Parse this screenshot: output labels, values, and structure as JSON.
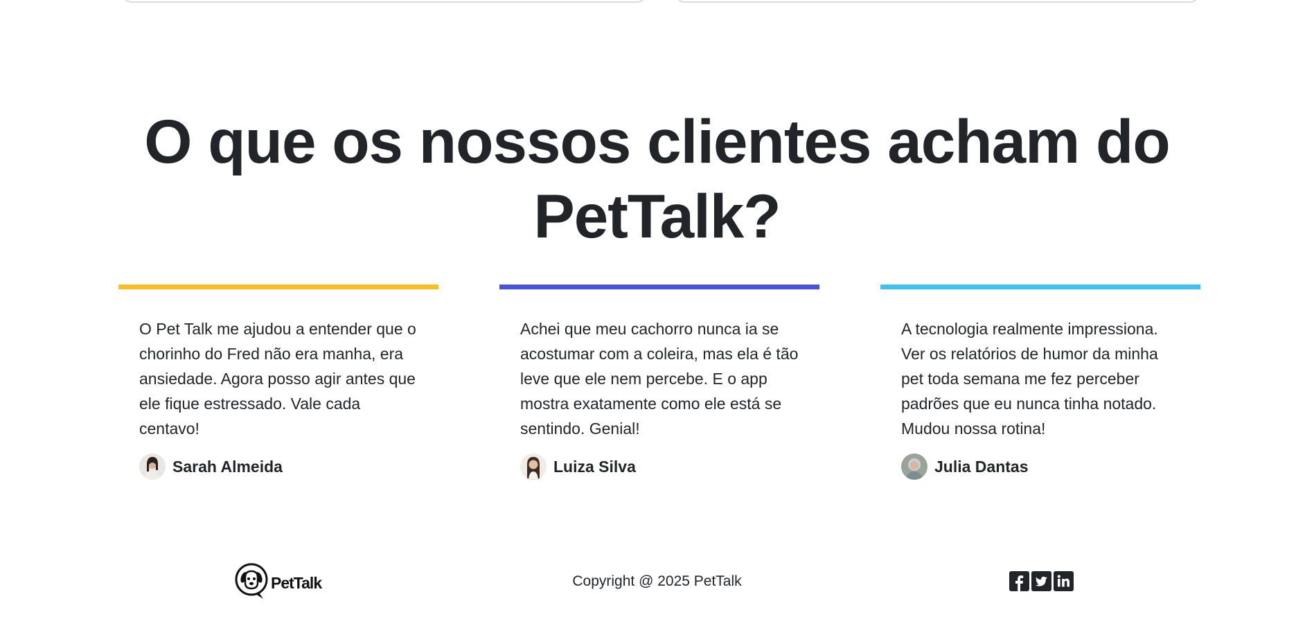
{
  "section": {
    "heading": "O que os nossos clientes acham do PetTalk?"
  },
  "testimonials": [
    {
      "accent": "#fbbf24",
      "quote": "O Pet Talk me ajudou a entender que o chorinho do Fred não era manha, era ansiedade. Agora posso agir antes que ele fique estressado. Vale cada centavo!",
      "author": "Sarah Almeida"
    },
    {
      "accent": "#4753d9",
      "quote": "Achei que meu cachorro nunca ia se acostumar com a coleira, mas ela é tão leve que ele nem percebe. E o app mostra exatamente como ele está se sentindo. Genial!",
      "author": "Luiza Silva"
    },
    {
      "accent": "#3ec1ee",
      "quote": "A tecnologia realmente impressiona. Ver os relatórios de humor da minha pet toda semana me fez perceber padrões que eu nunca tinha notado. Mudou nossa rotina!",
      "author": "Julia Dantas"
    }
  ],
  "footer": {
    "brand": "PetTalk",
    "copyright": "Copyright @ 2025 PetTalk",
    "socials": [
      "facebook-icon",
      "twitter-icon",
      "linkedin-icon"
    ]
  }
}
